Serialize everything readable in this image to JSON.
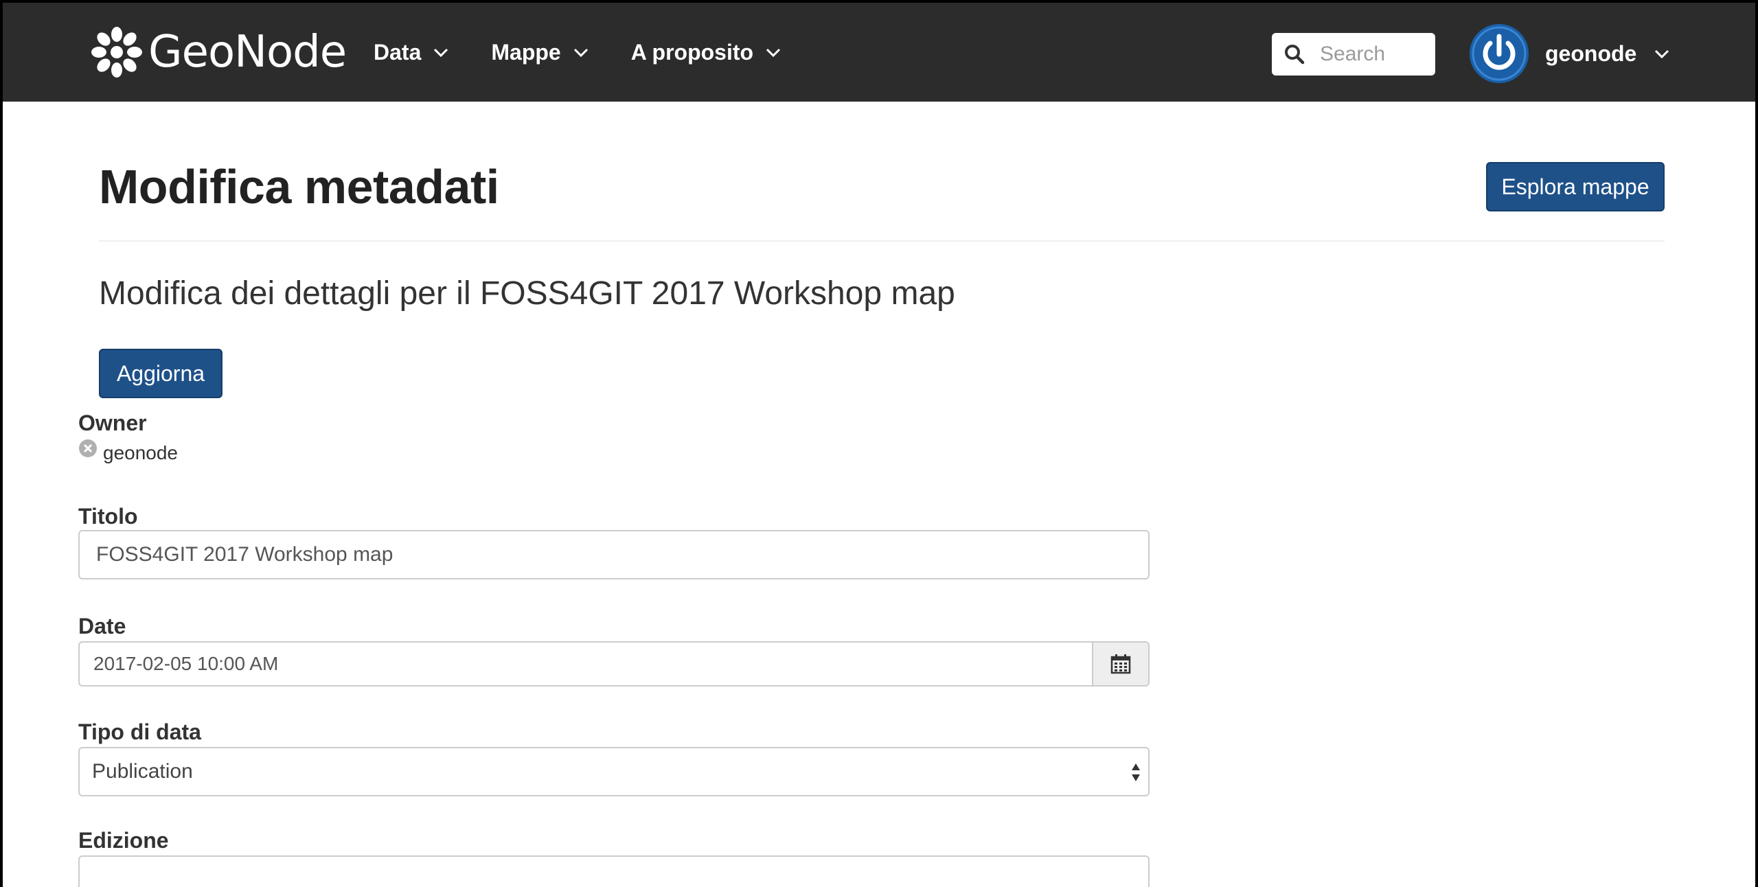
{
  "navbar": {
    "brand": "GeoNode",
    "menu": [
      {
        "label": "Data"
      },
      {
        "label": "Mappe"
      },
      {
        "label": "A proposito"
      }
    ],
    "search_placeholder": "Search",
    "user": "geonode"
  },
  "header": {
    "title": "Modifica metadati",
    "explore_button": "Esplora mappe",
    "subtitle": "Modifica dei dettagli per il FOSS4GIT 2017 Workshop map",
    "update_button": "Aggiorna"
  },
  "form": {
    "owner_label": "Owner",
    "owner_value": "geonode",
    "title_label": "Titolo",
    "title_value": "FOSS4GIT 2017 Workshop map",
    "date_label": "Date",
    "date_value": "2017-02-05 10:00 AM",
    "date_type_label": "Tipo di data",
    "date_type_value": "Publication",
    "edition_label": "Edizione",
    "edition_value": ""
  },
  "colors": {
    "navbar_bg": "#2c2c2c",
    "primary_button": "#1f5189",
    "avatar": "#1a5fa8"
  },
  "icons": {
    "brand": "geonode-logo-icon",
    "nav_dropdown": "chevron-down-icon",
    "search": "search-icon",
    "avatar": "power-icon",
    "owner_remove": "remove-circle-icon",
    "calendar": "calendar-icon",
    "select": "select-arrows-icon"
  }
}
